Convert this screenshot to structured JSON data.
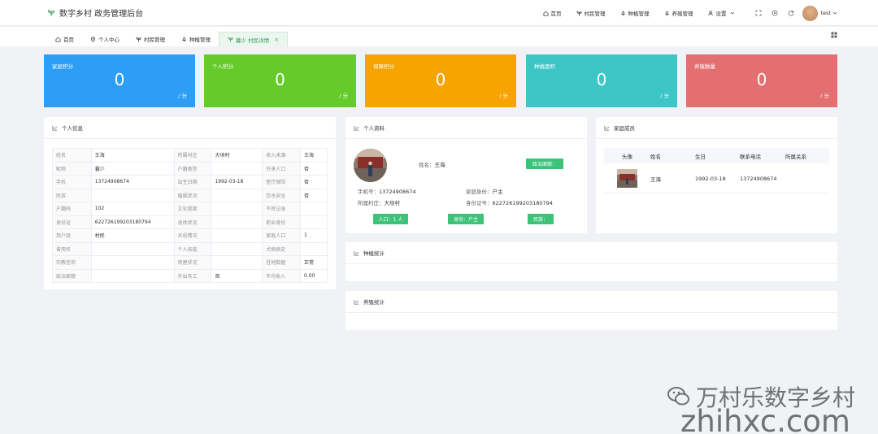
{
  "header": {
    "app_title": "数字乡村 政务管理后台",
    "nav": [
      {
        "label": "首页",
        "icon": "home-icon"
      },
      {
        "label": "村民管理",
        "icon": "sprout-icon"
      },
      {
        "label": "种植管理",
        "icon": "tree-icon"
      },
      {
        "label": "养殖管理",
        "icon": "tree-icon"
      },
      {
        "label": "设置",
        "icon": "user-gear-icon"
      }
    ],
    "username": "test"
  },
  "tabs": [
    {
      "label": "首页",
      "icon": "home-icon"
    },
    {
      "label": "个人中心",
      "icon": "location-icon"
    },
    {
      "label": "村民管理",
      "icon": "sprout-icon"
    },
    {
      "label": "种植管理",
      "icon": "tree-icon"
    },
    {
      "label": "暮少 村民详情",
      "icon": "sprout-icon",
      "active": true
    }
  ],
  "stats": [
    {
      "label": "家庭积分",
      "value": "0",
      "unit": "/ 分",
      "color": "#2d9ef5"
    },
    {
      "label": "个人积分",
      "value": "0",
      "unit": "/ 分",
      "color": "#65cb2b"
    },
    {
      "label": "保障积分",
      "value": "0",
      "unit": "/ 分",
      "color": "#f7a300"
    },
    {
      "label": "种植面积",
      "value": "0",
      "unit": "/ 分",
      "color": "#3cc6c6"
    },
    {
      "label": "养殖数量",
      "value": "0",
      "unit": "/ 分",
      "color": "#e36f70"
    }
  ],
  "personal_info": {
    "title": "个人信息",
    "rows": [
      [
        "姓名",
        "王海",
        "所属村庄",
        "大坝村",
        "收入来源",
        "王海"
      ],
      [
        "昵称",
        "暮少",
        "户籍类型",
        "",
        "外来人口",
        "否"
      ],
      [
        "手机",
        "13724908674",
        "出生日期",
        "1992-03-18",
        "医疗保险",
        "否"
      ],
      [
        "民族",
        "",
        "婚姻状况",
        "",
        "饮水安全",
        "否"
      ],
      [
        "户籍码",
        "102",
        "文化程度",
        "",
        "不良记录",
        ""
      ],
      [
        "身份证",
        "622726199203180794",
        "身体状况",
        "",
        "职业身份",
        ""
      ],
      [
        "用户组",
        "村民",
        "兵役情况",
        "",
        "家庭人口",
        "1"
      ],
      [
        "曾用名",
        "",
        "个人技能",
        "",
        "犬病病史",
        ""
      ],
      [
        "宗教信仰",
        "",
        "房屋状况",
        "",
        "驻地数据",
        "正常"
      ],
      [
        "政治面貌",
        "",
        "外出务工",
        "否",
        "年均收入",
        "0.00"
      ]
    ]
  },
  "profile": {
    "title": "个人资料",
    "name_label": "姓名：",
    "name": "王海",
    "political_label": "政治面貌：",
    "phone_label": "手机号：",
    "phone": "13724908674",
    "family_role_label": "家庭身份：",
    "family_role": "户主",
    "village_label": "所属村庄：",
    "village": "大坝村",
    "id_label": "身份证号：",
    "id_number": "622726199203180794",
    "tag_population": "人口：1 人",
    "tag_identity": "身份：户主",
    "tag_ethnicity": "民族："
  },
  "family": {
    "title": "家庭成员",
    "columns": [
      "头像",
      "姓名",
      "生日",
      "联系电话",
      "所属关系"
    ],
    "rows": [
      {
        "name": "王海",
        "birthday": "1992-03-18",
        "phone": "13724908674",
        "relation": ""
      }
    ]
  },
  "planting_stats": {
    "title": "种植统计"
  },
  "breeding_stats": {
    "title": "养殖统计"
  },
  "watermark": {
    "line1": "万村乐数字乡村",
    "line2": "zhihxc.com"
  }
}
